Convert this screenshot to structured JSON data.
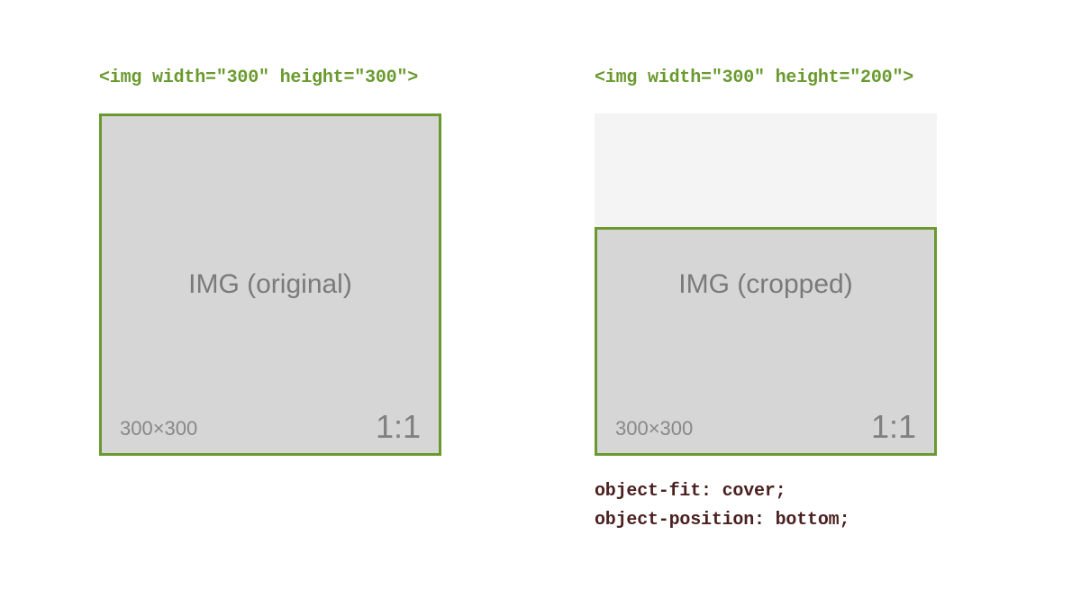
{
  "left": {
    "heading": "<img width=\"300\" height=\"300\">",
    "center_label": "IMG (original)",
    "dim_label": "300×300",
    "ratio_label": "1:1"
  },
  "right": {
    "heading": "<img width=\"300\" height=\"200\">",
    "center_label": "IMG (cropped)",
    "dim_label": "300×300",
    "ratio_label": "1:1",
    "css_line1": "object-fit: cover;",
    "css_line2": "object-position: bottom;"
  }
}
